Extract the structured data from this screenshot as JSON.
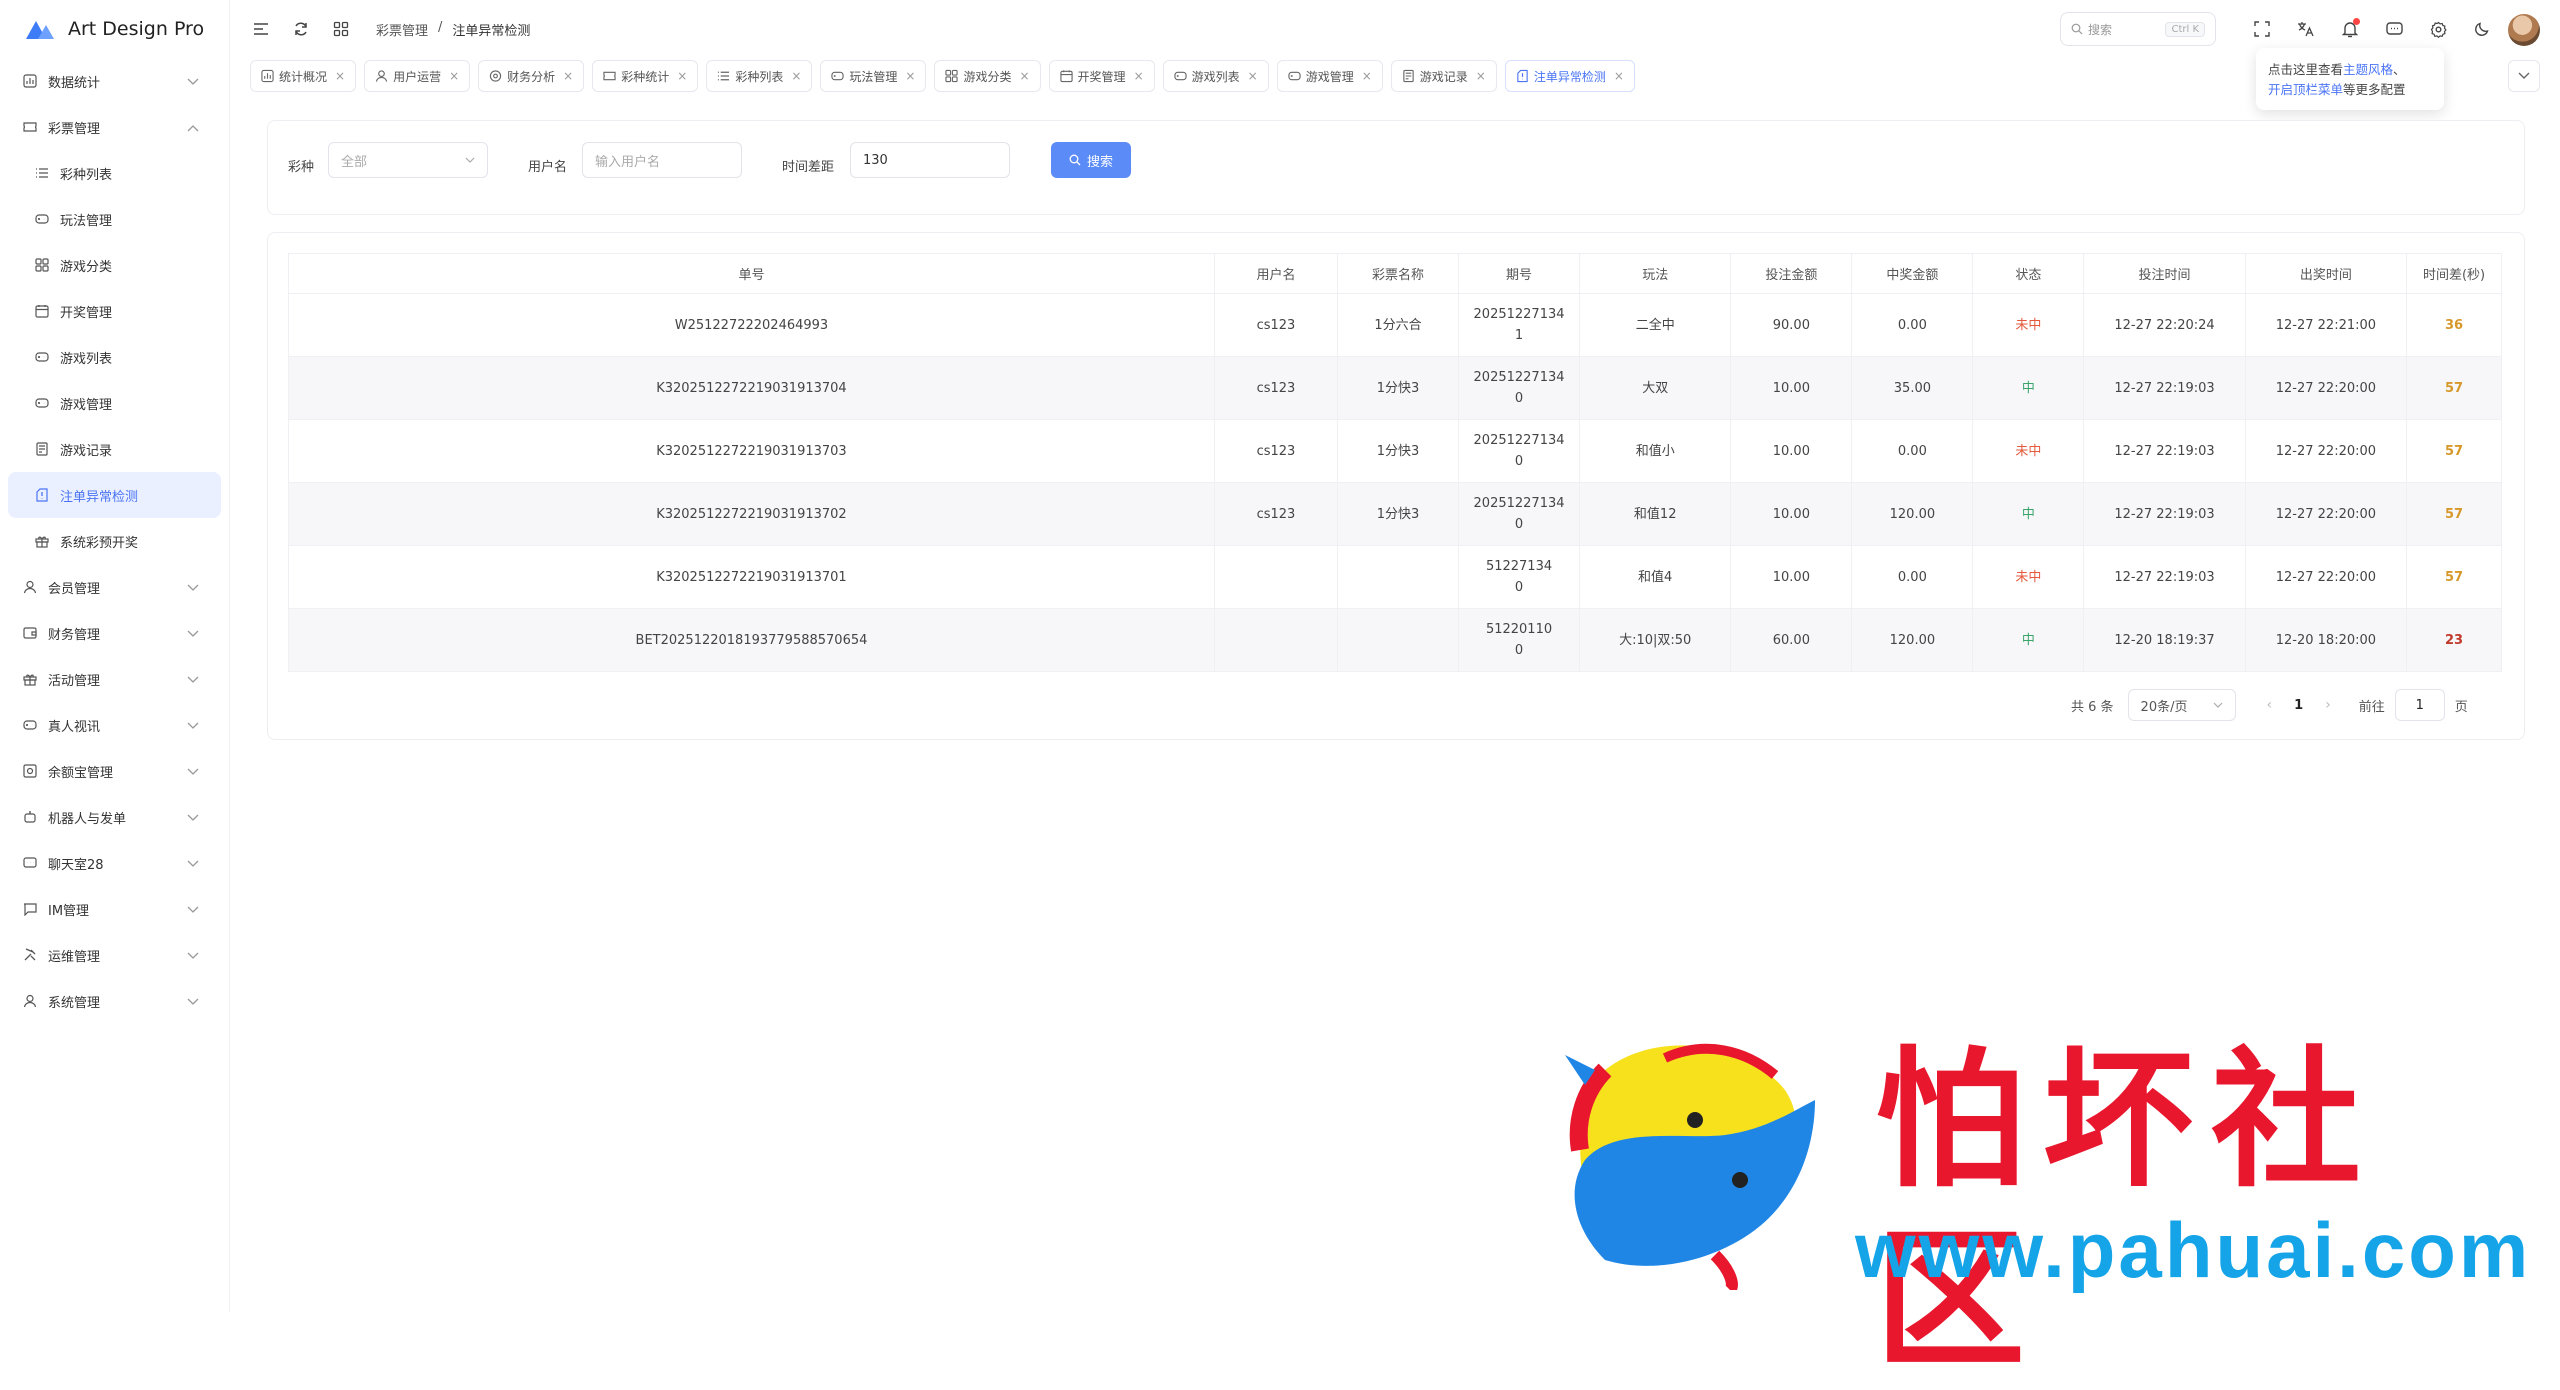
{
  "app": {
    "name": "Art Design Pro"
  },
  "sidebar": {
    "items": [
      {
        "label": "数据统计",
        "icon": "chart-icon",
        "expandable": true
      },
      {
        "label": "彩票管理",
        "icon": "ticket-icon",
        "expandable": true,
        "expanded": true
      },
      {
        "label": "彩种列表",
        "icon": "list-icon",
        "sub": true
      },
      {
        "label": "玩法管理",
        "icon": "gamepad-icon",
        "sub": true
      },
      {
        "label": "游戏分类",
        "icon": "grid-icon",
        "sub": true
      },
      {
        "label": "开奖管理",
        "icon": "calendar-icon",
        "sub": true
      },
      {
        "label": "游戏列表",
        "icon": "gamepad-icon",
        "sub": true
      },
      {
        "label": "游戏管理",
        "icon": "gamepad-icon",
        "sub": true
      },
      {
        "label": "游戏记录",
        "icon": "record-icon",
        "sub": true
      },
      {
        "label": "注单异常检测",
        "icon": "alert-doc-icon",
        "sub": true,
        "active": true
      },
      {
        "label": "系统彩预开奖",
        "icon": "gift-icon",
        "sub": true
      },
      {
        "label": "会员管理",
        "icon": "user-icon",
        "expandable": true
      },
      {
        "label": "财务管理",
        "icon": "wallet-icon",
        "expandable": true
      },
      {
        "label": "活动管理",
        "icon": "gift-icon",
        "expandable": true
      },
      {
        "label": "真人视讯",
        "icon": "gamepad-icon",
        "expandable": true
      },
      {
        "label": "余额宝管理",
        "icon": "safe-icon",
        "expandable": true
      },
      {
        "label": "机器人与发单",
        "icon": "robot-icon",
        "expandable": true
      },
      {
        "label": "聊天室28",
        "icon": "chat-icon",
        "expandable": true
      },
      {
        "label": "IM管理",
        "icon": "message-icon",
        "expandable": true
      },
      {
        "label": "运维管理",
        "icon": "tools-icon",
        "expandable": true
      },
      {
        "label": "系统管理",
        "icon": "user-icon",
        "expandable": true
      }
    ]
  },
  "header": {
    "breadcrumb": [
      "彩票管理",
      "/",
      "注单异常检测"
    ],
    "search_placeholder": "搜索",
    "search_kbd": "Ctrl K",
    "tip_line1_prefix": "点击这里查看",
    "tip_line1_link": "主题风格",
    "tip_line1_suffix": "、",
    "tip_line2_link": "开启顶栏菜单",
    "tip_line2_suffix": "等更多配置"
  },
  "tabs": [
    {
      "label": "统计概况",
      "icon": "chart-icon"
    },
    {
      "label": "用户运营",
      "icon": "user-icon"
    },
    {
      "label": "财务分析",
      "icon": "coin-icon"
    },
    {
      "label": "彩种统计",
      "icon": "ticket-icon"
    },
    {
      "label": "彩种列表",
      "icon": "list-icon"
    },
    {
      "label": "玩法管理",
      "icon": "gamepad-icon"
    },
    {
      "label": "游戏分类",
      "icon": "grid-icon"
    },
    {
      "label": "开奖管理",
      "icon": "calendar-icon"
    },
    {
      "label": "游戏列表",
      "icon": "gamepad-icon"
    },
    {
      "label": "游戏管理",
      "icon": "gamepad-icon"
    },
    {
      "label": "游戏记录",
      "icon": "record-icon"
    },
    {
      "label": "注单异常检测",
      "icon": "alert-doc-icon",
      "active": true
    }
  ],
  "filter": {
    "lottery_label": "彩种",
    "lottery_value": "全部",
    "user_label": "用户名",
    "user_placeholder": "输入用户名",
    "diff_label": "时间差距",
    "diff_value": "130",
    "search_button": "搜索"
  },
  "table": {
    "headers": [
      "单号",
      "用户名",
      "彩票名称",
      "期号",
      "玩法",
      "投注金额",
      "中奖金额",
      "状态",
      "投注时间",
      "出奖时间",
      "时间差(秒)"
    ],
    "rows": [
      {
        "id": "W25122722202464993",
        "user": "cs123",
        "lottery": "1分六合",
        "issue1": "20251227134",
        "issue2": "1",
        "play": "二全中",
        "bet": "90.00",
        "win": "0.00",
        "status": "未中",
        "bet_time": "12-27 22:20:24",
        "draw_time": "12-27 22:21:00",
        "diff": "36"
      },
      {
        "id": "K3202512272219031913704",
        "user": "cs123",
        "lottery": "1分快3",
        "issue1": "20251227134",
        "issue2": "0",
        "play": "大双",
        "bet": "10.00",
        "win": "35.00",
        "status": "中",
        "bet_time": "12-27 22:19:03",
        "draw_time": "12-27 22:20:00",
        "diff": "57"
      },
      {
        "id": "K3202512272219031913703",
        "user": "cs123",
        "lottery": "1分快3",
        "issue1": "20251227134",
        "issue2": "0",
        "play": "和值小",
        "bet": "10.00",
        "win": "0.00",
        "status": "未中",
        "bet_time": "12-27 22:19:03",
        "draw_time": "12-27 22:20:00",
        "diff": "57"
      },
      {
        "id": "K3202512272219031913702",
        "user": "cs123",
        "lottery": "1分快3",
        "issue1": "20251227134",
        "issue2": "0",
        "play": "和值12",
        "bet": "10.00",
        "win": "120.00",
        "status": "中",
        "bet_time": "12-27 22:19:03",
        "draw_time": "12-27 22:20:00",
        "diff": "57"
      },
      {
        "id": "K3202512272219031913701",
        "user": "",
        "lottery": "",
        "issue1": "51227134",
        "issue2": "0",
        "play": "和值4",
        "bet": "10.00",
        "win": "0.00",
        "status": "未中",
        "bet_time": "12-27 22:19:03",
        "draw_time": "12-27 22:20:00",
        "diff": "57"
      },
      {
        "id": "BET2025122018193779588570654",
        "user": "",
        "lottery": "",
        "issue1": "51220110",
        "issue2": "0",
        "play": "大:10|双:50",
        "bet": "60.00",
        "win": "120.00",
        "status": "中",
        "bet_time": "12-20 18:19:37",
        "draw_time": "12-20 18:20:00",
        "diff": "23"
      }
    ]
  },
  "pagination": {
    "total": "共 6 条",
    "page_size": "20条/页",
    "current": "1",
    "goto_label": "前往",
    "goto_value": "1",
    "page_unit": "页"
  },
  "watermark": {
    "text": "怕坏社区",
    "url": "www.pahuai.com"
  },
  "colors": {
    "accent": "#4a74f5",
    "danger": "#e55a3c",
    "success": "#3aa56b",
    "warning": "#d7982a"
  }
}
